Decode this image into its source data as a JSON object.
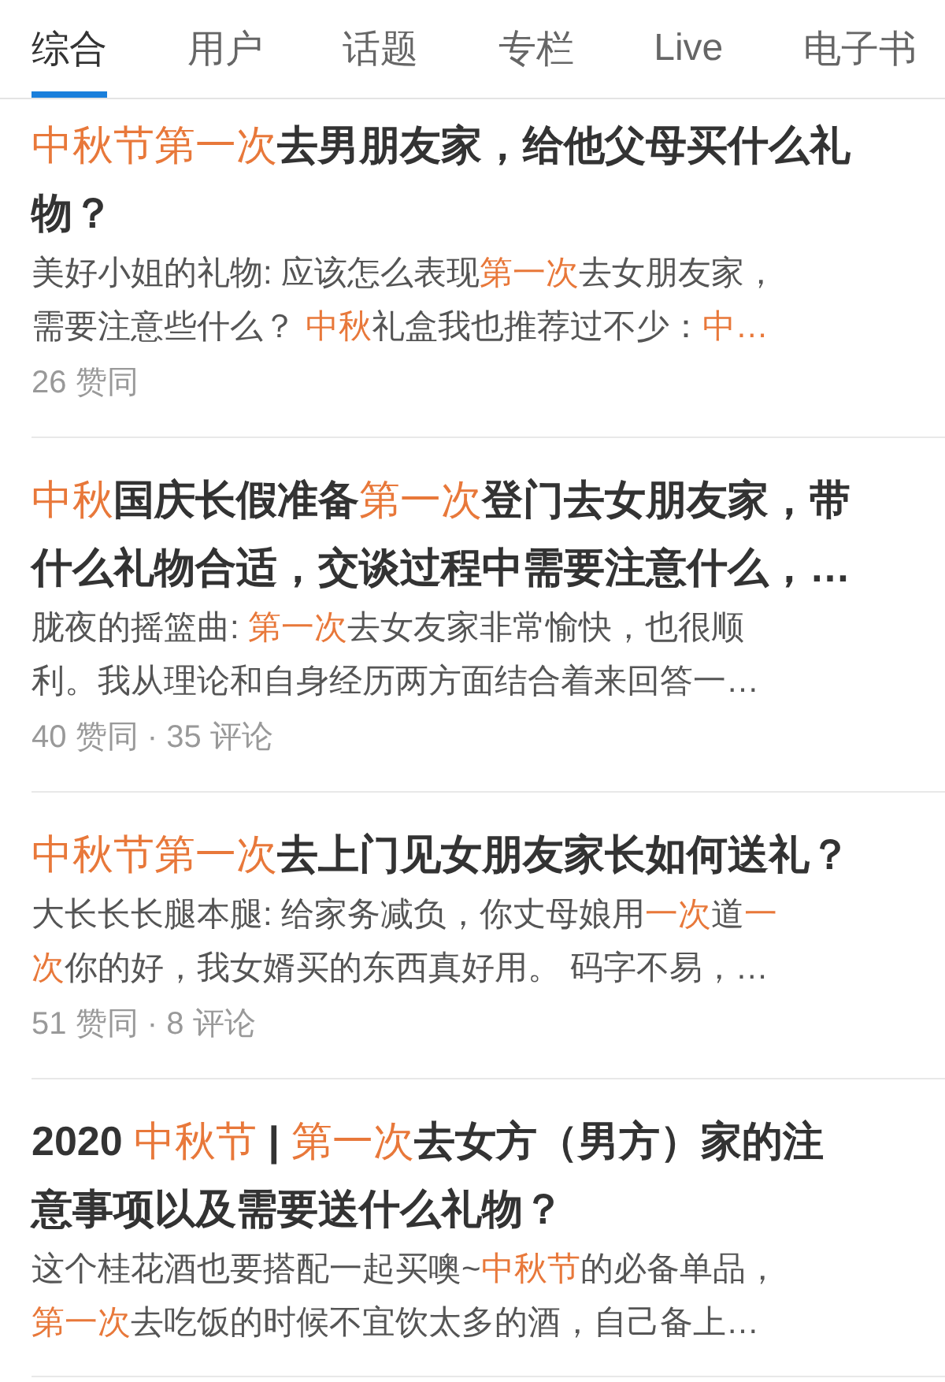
{
  "tabs": [
    {
      "label": "综合",
      "selected": true
    },
    {
      "label": "用户",
      "selected": false
    },
    {
      "label": "话题",
      "selected": false
    },
    {
      "label": "专栏",
      "selected": false
    },
    {
      "label": "Live",
      "selected": false
    },
    {
      "label": "电子书",
      "selected": false
    }
  ],
  "results": [
    {
      "title": [
        [
          {
            "text": "中秋节第一次",
            "highlight": true
          },
          {
            "text": "去男朋友家，给他父母买什么礼",
            "highlight": false
          }
        ],
        [
          {
            "text": "物？",
            "highlight": false
          }
        ]
      ],
      "snippet": [
        [
          {
            "text": "美好小姐的礼物: 应该怎么表现",
            "highlight": false
          },
          {
            "text": "第一次",
            "highlight": true
          },
          {
            "text": "去女朋友家，",
            "highlight": false
          }
        ],
        [
          {
            "text": "需要注意些什么？ ",
            "highlight": false
          },
          {
            "text": "中秋",
            "highlight": true
          },
          {
            "text": "礼盒我也推荐过不少：",
            "highlight": false
          },
          {
            "text": "中…",
            "highlight": true
          }
        ]
      ],
      "meta": "26 赞同"
    },
    {
      "title": [
        [
          {
            "text": "中秋",
            "highlight": true
          },
          {
            "text": "国庆长假准备",
            "highlight": false
          },
          {
            "text": "第一次",
            "highlight": true
          },
          {
            "text": "登门去女朋友家，带",
            "highlight": false
          }
        ],
        [
          {
            "text": "什么礼物合适，交谈过程中需要注意什么，…",
            "highlight": false
          }
        ]
      ],
      "snippet": [
        [
          {
            "text": "胧夜的摇篮曲: ",
            "highlight": false
          },
          {
            "text": "第一次",
            "highlight": true
          },
          {
            "text": "去女友家非常愉快，也很顺",
            "highlight": false
          }
        ],
        [
          {
            "text": "利。我从理论和自身经历两方面结合着来回答一…",
            "highlight": false
          }
        ]
      ],
      "meta": "40 赞同 · 35 评论"
    },
    {
      "title": [
        [
          {
            "text": "中秋节第一次",
            "highlight": true
          },
          {
            "text": "去上门见女朋友家长如何送礼？",
            "highlight": false
          }
        ]
      ],
      "snippet": [
        [
          {
            "text": "大长长长腿本腿: 给家务减负，你丈母娘用",
            "highlight": false
          },
          {
            "text": "一次",
            "highlight": true
          },
          {
            "text": "道",
            "highlight": false
          },
          {
            "text": "一",
            "highlight": true
          }
        ],
        [
          {
            "text": "次",
            "highlight": true
          },
          {
            "text": "你的好，我女婿买的东西真好用。 码字不易，…",
            "highlight": false
          }
        ]
      ],
      "meta": "51 赞同 · 8 评论"
    },
    {
      "title": [
        [
          {
            "text": "2020 ",
            "highlight": false
          },
          {
            "text": "中秋节",
            "highlight": true
          },
          {
            "text": " | ",
            "highlight": false
          },
          {
            "text": "第一次",
            "highlight": true
          },
          {
            "text": "去女方（男方）家的注",
            "highlight": false
          }
        ],
        [
          {
            "text": "意事项以及需要送什么礼物？",
            "highlight": false
          }
        ]
      ],
      "snippet": [
        [
          {
            "text": "这个桂花酒也要搭配一起买噢~",
            "highlight": false
          },
          {
            "text": "中秋节",
            "highlight": true
          },
          {
            "text": "的必备单品，",
            "highlight": false
          }
        ],
        [
          {
            "text": "第一次",
            "highlight": true
          },
          {
            "text": "去吃饭的时候不宜饮太多的酒，自己备上…",
            "highlight": false
          }
        ]
      ]
    }
  ]
}
